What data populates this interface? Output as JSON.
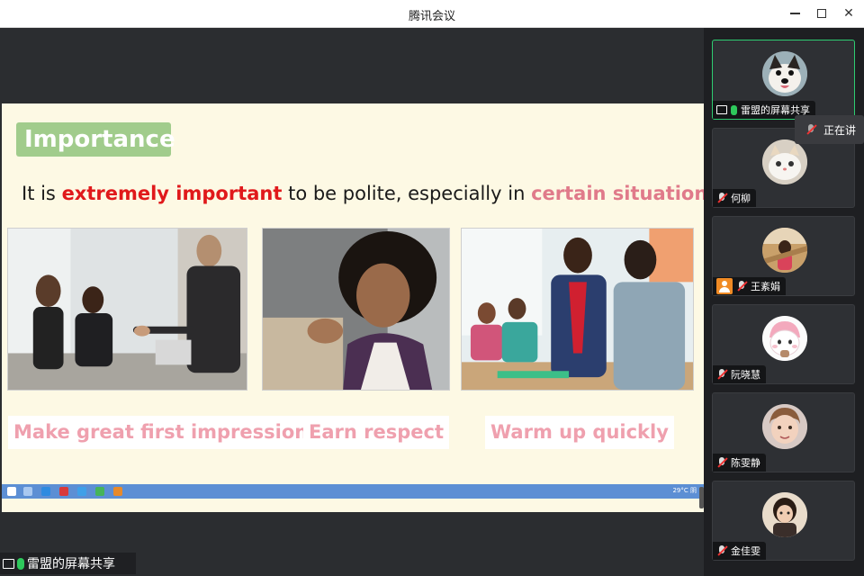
{
  "window": {
    "title": "腾讯会议"
  },
  "slide": {
    "tag": "Importance",
    "headline": {
      "part1": "It is ",
      "highlight1": "extremely important",
      "part2": " to be polite, especially in ",
      "highlight2": "certain situations",
      "part3": "."
    },
    "captions": [
      "Make great first impression",
      "Earn respect",
      "Warm up quickly"
    ],
    "colors": {
      "tag_bg": "#a1cc8c",
      "highlight_red": "#e0191b",
      "highlight_pink": "#e07a8a",
      "caption": "#efa0ae",
      "slide_bg": "#fdf9e4"
    }
  },
  "share": {
    "label": "雷盟的屏幕共享"
  },
  "participants": [
    {
      "name": "雷盟的屏幕共享",
      "status": "sharing",
      "avatar": "dog-avatar"
    },
    {
      "name": "何柳",
      "status": "muted",
      "avatar": "cat-avatar"
    },
    {
      "name": "王紊娟",
      "status": "muted",
      "avatar": "child-avatar"
    },
    {
      "name": "阮晓慧",
      "status": "muted",
      "avatar": "cartoon-avatar"
    },
    {
      "name": "陈雯静",
      "status": "muted",
      "avatar": "baby-avatar"
    },
    {
      "name": "金佳雯",
      "status": "muted",
      "avatar": "girl-avatar"
    }
  ],
  "tooltip": {
    "label": "正在讲"
  },
  "taskbar": {
    "tray_text": "29°C 阴"
  }
}
